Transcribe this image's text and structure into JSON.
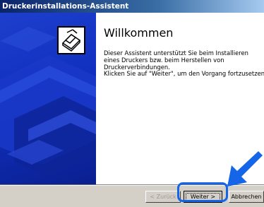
{
  "window": {
    "title": "Druckerinstallations-Assistent"
  },
  "main": {
    "heading": "Willkommen",
    "paragraph1": "Dieser Assistent unterstützt Sie beim Installieren eines Druckers bzw. beim Herstellen von Druckerverbindungen.",
    "paragraph2": "Klicken Sie auf \"Weiter\", um den Vorgang fortzusetzen."
  },
  "buttons": {
    "back_label": "< Zurück",
    "next_label": "Weiter >",
    "cancel_label": "Abbrechen"
  },
  "icons": {
    "wizard_icon": "printer-icon",
    "pointer": "arrow-pointer-icon"
  },
  "colors": {
    "titlebar_start": "#0a246a",
    "sidebar_blue": "#1030c0",
    "highlight": "#1565e8",
    "button_face": "#d4d0c8"
  }
}
